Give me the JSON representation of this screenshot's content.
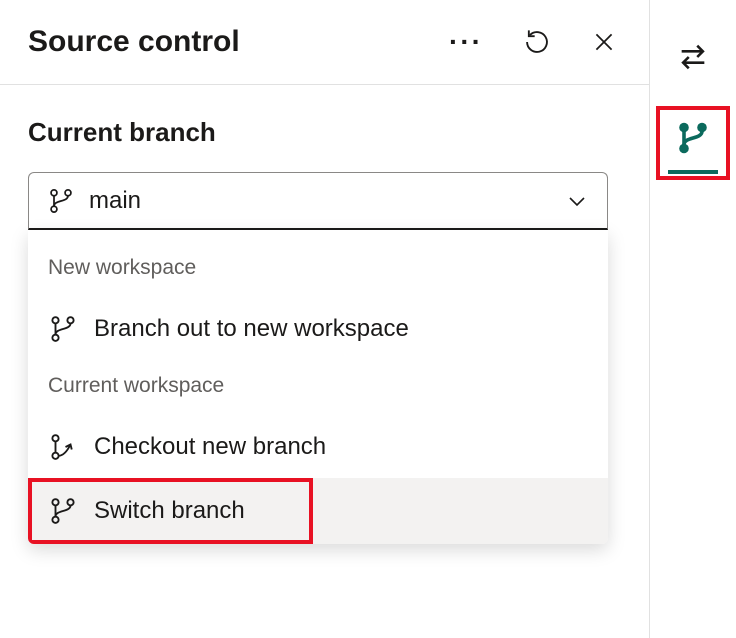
{
  "header": {
    "title": "Source control",
    "icons": {
      "more": "more-icon",
      "refresh": "refresh-icon",
      "close": "close-icon"
    }
  },
  "section": {
    "heading": "Current branch",
    "selected_branch": "main"
  },
  "dropdown": {
    "groups": [
      {
        "label": "New workspace",
        "items": [
          {
            "icon": "branch-out-icon",
            "label": "Branch out to new workspace"
          }
        ]
      },
      {
        "label": "Current workspace",
        "items": [
          {
            "icon": "branch-checkout-icon",
            "label": "Checkout new branch"
          },
          {
            "icon": "branch-switch-icon",
            "label": "Switch branch"
          }
        ]
      }
    ]
  },
  "rail": {
    "swap_icon": "swap-icon",
    "source_control_icon": "source-control-icon"
  },
  "colors": {
    "highlight": "#e81123",
    "teal": "#0b6a5d"
  }
}
